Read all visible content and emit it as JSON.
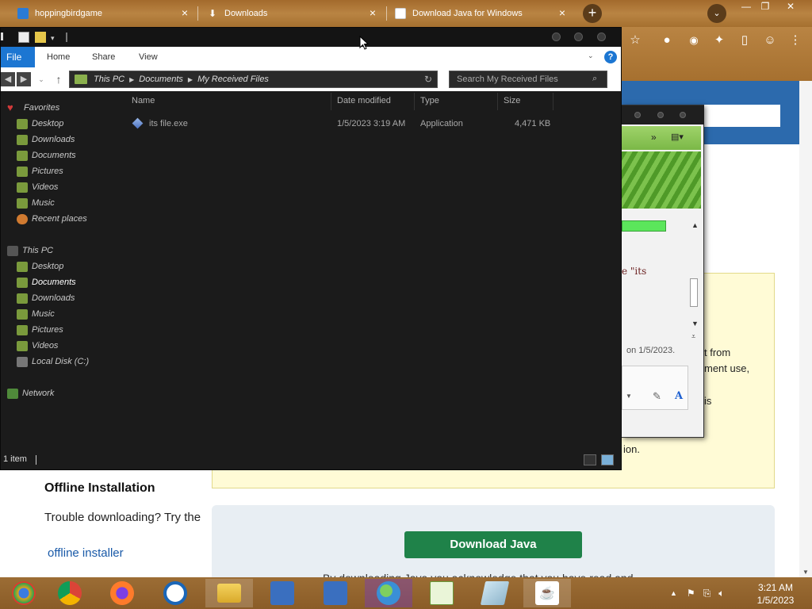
{
  "browser": {
    "tabs": [
      {
        "title": "hoppingbirdgame",
        "close": "×"
      },
      {
        "title": "Downloads",
        "close": "×"
      },
      {
        "title": "Download Java for Windows",
        "close": "×"
      }
    ],
    "new_tab": "+",
    "tab_dropdown": "⌄",
    "window_controls": {
      "minimize": "—",
      "restore": "❐",
      "close": "✕"
    },
    "toolbar_icons": [
      "star-icon",
      "extension-icon",
      "sidebar-icon",
      "profile-icon",
      "menu-icon"
    ]
  },
  "webpage": {
    "yellow_box": {
      "line_from": "t from",
      "line_ment": "ment use,",
      "line_is": "is",
      "line_ion": "ion."
    },
    "offline": {
      "title": "Offline Installation",
      "desc": "Trouble downloading? Try the",
      "link": "offline installer"
    },
    "download_button": "Download Java",
    "ack": "By downloading Java you acknowledge that you have read and"
  },
  "installer": {
    "toolbar_more": "»",
    "text_its": "e \"its",
    "text_date": "on 1/5/2023."
  },
  "explorer": {
    "ribbon": {
      "file": "File",
      "tabs": [
        "Home",
        "Share",
        "View"
      ],
      "help": "?"
    },
    "address": {
      "crumbs": [
        "This PC",
        "Documents",
        "My Received Files"
      ]
    },
    "search_placeholder": "Search My Received Files",
    "nav": {
      "favorites": "Favorites",
      "favorites_items": [
        "Desktop",
        "Downloads",
        "Documents",
        "Pictures",
        "Videos",
        "Music",
        "Recent places"
      ],
      "this_pc": "This PC",
      "this_pc_items": [
        "Desktop",
        "Documents",
        "Downloads",
        "Music",
        "Pictures",
        "Videos",
        "Local Disk (C:)"
      ],
      "network": "Network"
    },
    "columns": [
      "Name",
      "Date modified",
      "Type",
      "Size"
    ],
    "files": [
      {
        "name": "its file.exe",
        "date": "1/5/2023 3:19 AM",
        "type": "Application",
        "size": "4,471 KB"
      }
    ],
    "status": "1 item"
  },
  "taskbar": {
    "apps": [
      "chrome-like-icon",
      "chrome-icon",
      "firefox-icon",
      "opera-icon",
      "file-explorer-icon",
      "network-monitor-icon",
      "network-monitor-icon",
      "people-icon",
      "notepad-icon",
      "paper-icon",
      "java-icon"
    ],
    "clock_time": "3:21 AM",
    "clock_date": "1/5/2023"
  },
  "colors": {
    "taskbar": "#8a5c27",
    "explorer_bg": "#1b1b1b",
    "file_tab": "#1c76d2",
    "download_button": "#1f8249",
    "web_header": "#2c6aad"
  }
}
